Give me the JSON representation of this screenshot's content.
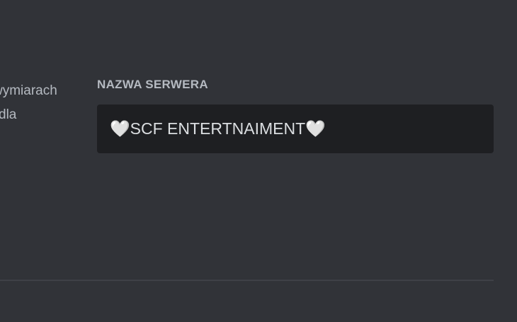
{
  "left_panel": {
    "description_line1": "wymiarach",
    "description_line2": "dla"
  },
  "server_name": {
    "label": "NAZWA SERWERA",
    "value": "🤍SCF ENTERTNAIMENT🤍"
  },
  "colors": {
    "background": "#313338",
    "input_background": "#1e1f22",
    "label_text": "#b5bac1",
    "input_text": "#dbdee1",
    "divider": "#3f4147"
  }
}
